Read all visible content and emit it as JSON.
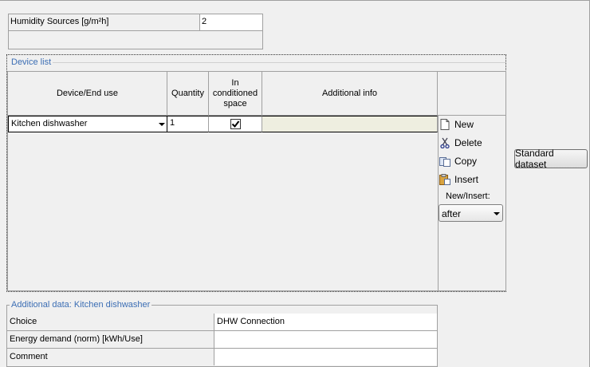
{
  "humidity": {
    "label": "Humidity Sources  [g/m²h]",
    "value": "2"
  },
  "device_list": {
    "title": "Device list",
    "columns": [
      "Device/End use",
      "Quantity",
      "In conditioned space",
      "Additional info"
    ],
    "rows": [
      {
        "device": "Kitchen dishwasher",
        "quantity": "1",
        "in_conditioned_space": true,
        "additional_info": ""
      }
    ],
    "toolbar": {
      "new": "New",
      "delete": "Delete",
      "copy": "Copy",
      "insert": "Insert",
      "new_insert_label": "New/Insert:",
      "new_insert_value": "after"
    }
  },
  "standard_dataset_button": "Standard dataset",
  "additional_data": {
    "title": "Additional data: Kitchen dishwasher",
    "rows": [
      {
        "label": "Choice",
        "value": "DHW Connection"
      },
      {
        "label": "Energy demand (norm) [kWh/Use]",
        "value": ""
      },
      {
        "label": "Comment",
        "value": ""
      }
    ]
  },
  "colors": {
    "accent": "#3c6eb4",
    "cell_info_bg": "#eeeee0"
  }
}
